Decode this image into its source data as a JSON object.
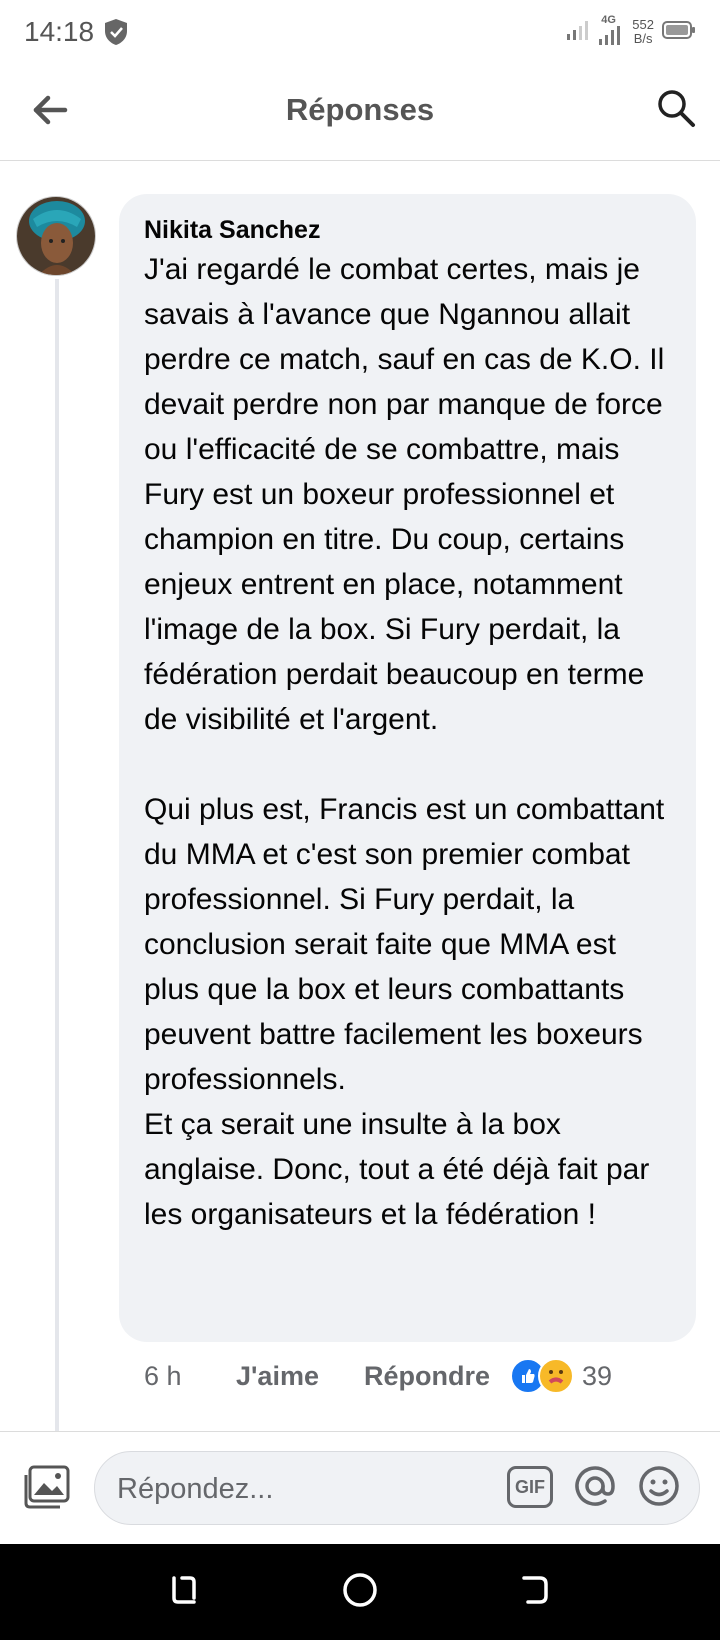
{
  "status_bar": {
    "time": "14:18",
    "network": "4G",
    "net_speed_value": "552",
    "net_speed_unit": "B/s",
    "icons": [
      "shield-icon",
      "signal-icon",
      "signal-4g-icon",
      "battery-icon"
    ]
  },
  "header": {
    "title": "Réponses",
    "back_icon": "arrow-left-icon",
    "search_icon": "search-icon"
  },
  "comment": {
    "author": "Nikita Sanchez",
    "text": "J'ai regardé le combat certes, mais je savais à l'avance que Ngannou allait perdre ce match, sauf en cas de K.O. Il devait perdre non par manque de force ou l'efficacité de se combattre, mais Fury est un boxeur professionnel et champion en titre. Du coup, certains enjeux entrent en place, notamment l'image de la box. Si Fury perdait, la fédération perdait beaucoup en terme de visibilité et l'argent.\n\nQui plus est, Francis est un combattant du MMA et c'est son premier combat professionnel. Si Fury perdait, la conclusion serait faite que MMA est plus que la box et leurs combattants peuvent battre facilement les boxeurs professionnels.\nEt ça serait une insulte à la box anglaise. Donc, tout a été déjà fait par les organisateurs et la fédération !",
    "time": "6 h",
    "like_label": "J'aime",
    "reply_label": "Répondre",
    "reactions": [
      "like",
      "care"
    ],
    "reaction_count": "39"
  },
  "composer": {
    "placeholder": "Répondez...",
    "gif_label": "GIF",
    "icons": [
      "photo-icon",
      "gif-icon",
      "mention-icon",
      "emoji-icon"
    ]
  },
  "nav_bar": {
    "icons": [
      "recent-apps-icon",
      "home-icon",
      "back-icon"
    ]
  },
  "colors": {
    "bubble_bg": "#f0f2f5",
    "text_primary": "#050505",
    "text_secondary": "#65676b",
    "accent_blue": "#1877f2",
    "nav_bg": "#000000"
  }
}
